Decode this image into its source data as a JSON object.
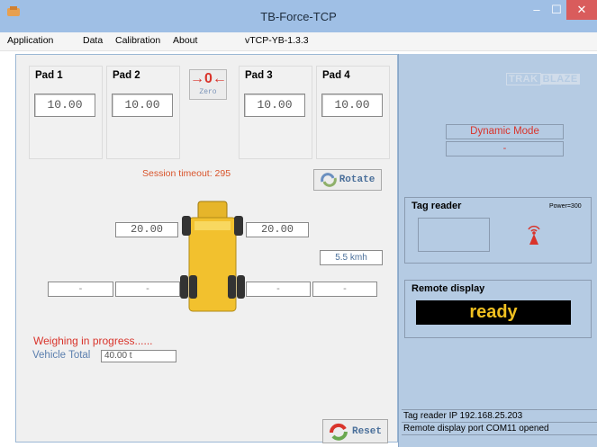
{
  "window": {
    "title": "TB-Force-TCP"
  },
  "menu": {
    "items": [
      "Application",
      "Data",
      "Calibration",
      "About"
    ],
    "version": "vTCP-YB-1.3.3"
  },
  "pads": [
    {
      "label": "Pad 1",
      "value": "10.00"
    },
    {
      "label": "Pad 2",
      "value": "10.00"
    },
    {
      "label": "Pad 3",
      "value": "10.00"
    },
    {
      "label": "Pad 4",
      "value": "10.00"
    }
  ],
  "zero_button": {
    "label": "Zero",
    "glyph": "0"
  },
  "rotate_button": {
    "label": "Rotate"
  },
  "reset_button": {
    "label": "Reset"
  },
  "session": {
    "label": "Session timeout:",
    "value": "295"
  },
  "axles": {
    "left": "20.00",
    "right": "20.00",
    "speed": "5.5 kmh",
    "blanks": [
      "-",
      "-",
      "-",
      "-"
    ]
  },
  "status": {
    "progress": "Weighing in progress......",
    "vehicle_total_label": "Vehicle Total",
    "vehicle_total_value": "40.00 t"
  },
  "brand": {
    "part1": "TRAK",
    "part2": "BLAZE"
  },
  "mode": {
    "label": "Dynamic Mode",
    "sub": "-"
  },
  "tag_reader": {
    "title": "Tag reader",
    "power": "Power=300"
  },
  "remote_display": {
    "title": "Remote display",
    "text": "ready"
  },
  "log": [
    "Tag reader IP 192.168.25.203",
    "Remote display port COM11 opened"
  ],
  "colors": {
    "accent_red": "#d9342b",
    "ready_yellow": "#f0c020",
    "truck_yellow": "#f2c12e"
  }
}
